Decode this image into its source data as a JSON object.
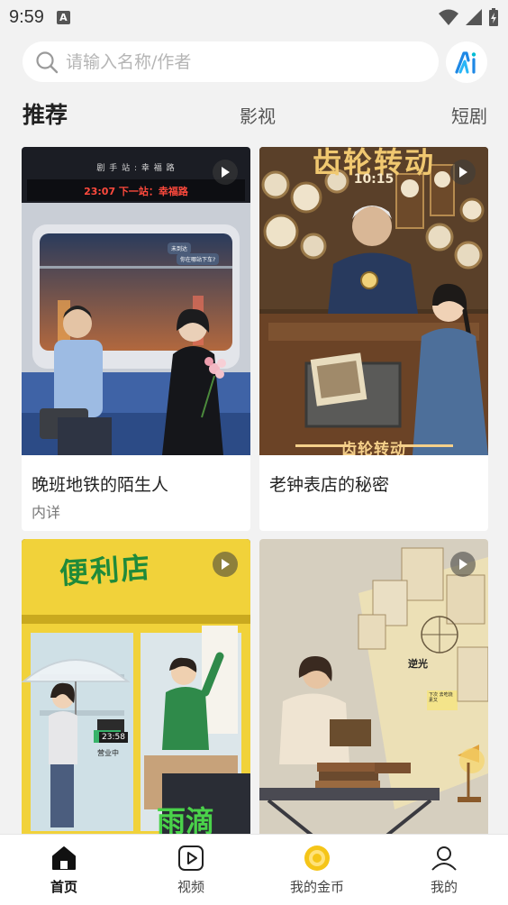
{
  "status": {
    "time": "9:59",
    "notification_glyph": "A"
  },
  "search": {
    "placeholder": "请输入名称/作者"
  },
  "ai_button": {
    "label": "AI",
    "icon": "ai-logo-icon",
    "color": "#1e88e5"
  },
  "tabs": [
    {
      "label": "推荐",
      "active": true
    },
    {
      "label": "影视",
      "active": false
    },
    {
      "label": "短剧",
      "active": false
    }
  ],
  "cards": [
    {
      "title": "晚班地铁的陌生人",
      "subtitle": "内详",
      "cover": {
        "sign_top": "剧 手 站 : 幸 福 路",
        "sign_main": "23:07  下一站：幸福路",
        "bubble_1": "未到达",
        "bubble_2": "你在哪站下车?"
      }
    },
    {
      "title": "老钟表店的秘密",
      "subtitle": "",
      "cover": {
        "banner": "齿轮转动",
        "time": "10:15",
        "bottom_banner": "齿轮转动"
      }
    },
    {
      "title": "",
      "subtitle": "",
      "cover": {
        "sign": "便利店",
        "clock": "23:58",
        "open_sign": "营业中",
        "banner": "雨滴"
      }
    },
    {
      "title": "",
      "subtitle": "",
      "cover": {
        "note_1": "逆光",
        "note_2": "下次 去吃烧素又"
      }
    }
  ],
  "bottom_nav": [
    {
      "label": "首页",
      "icon": "home-icon",
      "active": true
    },
    {
      "label": "视频",
      "icon": "video-play-icon",
      "active": false
    },
    {
      "label": "我的金币",
      "icon": "gold-coin-icon",
      "active": false
    },
    {
      "label": "我的",
      "icon": "user-icon",
      "active": false
    }
  ],
  "colors": {
    "accent": "#1e88e5",
    "background": "#f2f2f2",
    "coin": "#f5c518"
  }
}
